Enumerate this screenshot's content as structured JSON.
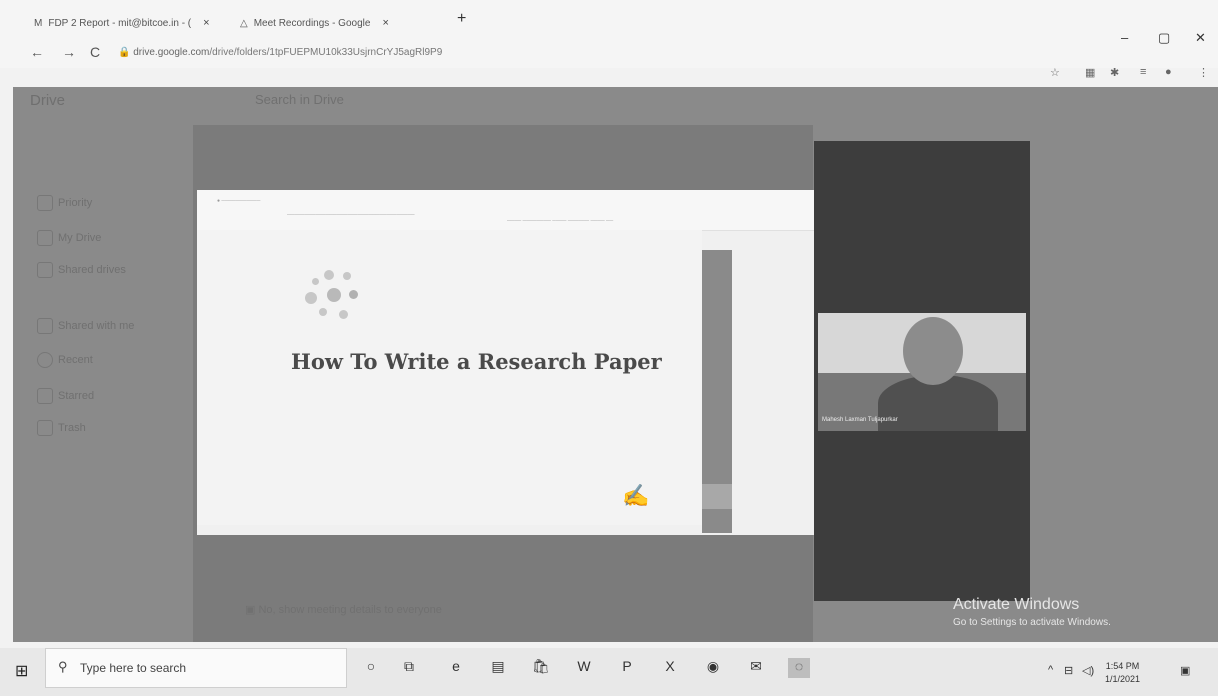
{
  "browser": {
    "tabs": [
      {
        "title": "FDP 2 Report - mit@bitcoe.in - (",
        "close": "×"
      },
      {
        "title": "Meet Recordings - Google",
        "close": "×"
      }
    ],
    "new_tab": "+",
    "url_domain": "drive.google.com",
    "url_path": "/drive/folders/1tpFUEPMU10k33UsjrnCrYJ5agRl9P9",
    "window_controls": {
      "minimize": "–",
      "maximize": "▢",
      "close": "✕"
    },
    "nav": {
      "back": "←",
      "forward": "→",
      "reload": "C"
    }
  },
  "drive": {
    "logo": "Drive",
    "search_placeholder": "Search in Drive",
    "sidebar": [
      "Priority",
      "My Drive",
      "Shared drives",
      "Shared with me",
      "Recent",
      "Starred",
      "Trash"
    ]
  },
  "slide": {
    "title": "How To Write a Research Paper"
  },
  "video": {
    "participant_name": "Mahesh Laxman Tuljapurkar"
  },
  "meet_bottom_text": "No, show meeting details to everyone",
  "watermark": {
    "line1": "Activate Windows",
    "line2": "Go to Settings to activate Windows."
  },
  "taskbar": {
    "search_placeholder": "Type here to search",
    "time": "1:54 PM",
    "date": "1/1/2021"
  },
  "colors": {
    "screen_gray": "#8a8a8a",
    "video_column": "#3d3d3d",
    "slide_bg": "#f3f3f3"
  }
}
